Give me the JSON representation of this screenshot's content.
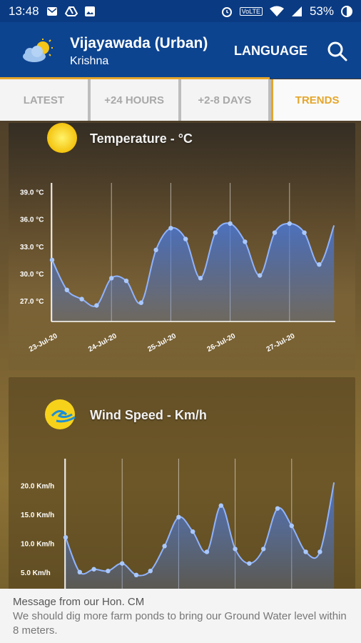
{
  "status_bar": {
    "time": "13:48",
    "battery": "53%",
    "volte": "VoLTE",
    "icons": [
      "email-icon",
      "drive-icon",
      "image-icon",
      "alarm-icon",
      "wifi-icon",
      "signal-icon",
      "battery-icon"
    ]
  },
  "app_bar": {
    "title": "Vijayawada (Urban)",
    "subtitle": "Krishna",
    "language_label": "LANGUAGE",
    "logo_icon": "cloud-sun-icon",
    "search_icon": "search-icon"
  },
  "tabs": [
    {
      "label": "LATEST",
      "active": false
    },
    {
      "label": "+24 HOURS",
      "active": false
    },
    {
      "label": "+2-8 DAYS",
      "active": false
    },
    {
      "label": "TRENDS",
      "active": true
    }
  ],
  "colors": {
    "primary": "#0d4490",
    "accent": "#e5a62b",
    "series_line": "#8fb3ff",
    "series_fill": "#4a78d6"
  },
  "chart_data": [
    {
      "type": "area",
      "title": "Temperature - °C",
      "ylim": [
        24.5,
        39.5
      ],
      "y_ticks": [
        39.0,
        36.0,
        33.0,
        30.0,
        27.0
      ],
      "y_tick_labels": [
        "39.0 °C",
        "36.0 °C",
        "33.0 °C",
        "30.0 °C",
        "27.0 °C"
      ],
      "x_tick_labels": [
        "23-Jul-20",
        "24-Jul-20",
        "25-Jul-20",
        "26-Jul-20",
        "27-Jul-20"
      ],
      "x_tick_positions": [
        0,
        4,
        8,
        12,
        16
      ],
      "points": [
        {
          "x": 0,
          "y": 31.5
        },
        {
          "x": 1,
          "y": 28.2
        },
        {
          "x": 2,
          "y": 27.2
        },
        {
          "x": 3,
          "y": 26.5
        },
        {
          "x": 4,
          "y": 29.5
        },
        {
          "x": 5,
          "y": 29.2
        },
        {
          "x": 6,
          "y": 26.8
        },
        {
          "x": 7,
          "y": 32.6
        },
        {
          "x": 8,
          "y": 35.0
        },
        {
          "x": 9,
          "y": 33.8
        },
        {
          "x": 10,
          "y": 29.5
        },
        {
          "x": 11,
          "y": 34.5
        },
        {
          "x": 12,
          "y": 35.5
        },
        {
          "x": 13,
          "y": 33.5
        },
        {
          "x": 14,
          "y": 29.8
        },
        {
          "x": 15,
          "y": 34.5
        },
        {
          "x": 16,
          "y": 35.5
        },
        {
          "x": 17,
          "y": 34.5
        },
        {
          "x": 18,
          "y": 31.0
        },
        {
          "x": 19,
          "y": 35.3
        }
      ],
      "marker_count": 19
    },
    {
      "type": "area",
      "title": "Wind Speed - Km/h",
      "ylim": [
        3.0,
        23.0
      ],
      "y_ticks": [
        20.0,
        15.0,
        10.0,
        5.0
      ],
      "y_tick_labels": [
        "20.0 Km/h",
        "15.0 Km/h",
        "10.0 Km/h",
        "5.0 Km/h"
      ],
      "x_tick_positions": [
        0,
        4,
        8,
        12,
        16
      ],
      "points": [
        {
          "x": 0,
          "y": 11.0
        },
        {
          "x": 1,
          "y": 5.0
        },
        {
          "x": 2,
          "y": 5.5
        },
        {
          "x": 3,
          "y": 5.2
        },
        {
          "x": 4,
          "y": 6.5
        },
        {
          "x": 5,
          "y": 4.5
        },
        {
          "x": 6,
          "y": 5.2
        },
        {
          "x": 7,
          "y": 9.5
        },
        {
          "x": 8,
          "y": 14.5
        },
        {
          "x": 9,
          "y": 12.0
        },
        {
          "x": 10,
          "y": 8.5
        },
        {
          "x": 11,
          "y": 16.5
        },
        {
          "x": 12,
          "y": 9.0
        },
        {
          "x": 13,
          "y": 6.5
        },
        {
          "x": 14,
          "y": 9.0
        },
        {
          "x": 15,
          "y": 16.0
        },
        {
          "x": 16,
          "y": 13.0
        },
        {
          "x": 17,
          "y": 8.5
        },
        {
          "x": 18,
          "y": 8.5
        },
        {
          "x": 19,
          "y": 20.5
        }
      ],
      "marker_count": 19
    }
  ],
  "message": {
    "title": "Message from our Hon. CM",
    "body": "We should dig more farm ponds to bring our Ground Water level within 8 meters."
  }
}
